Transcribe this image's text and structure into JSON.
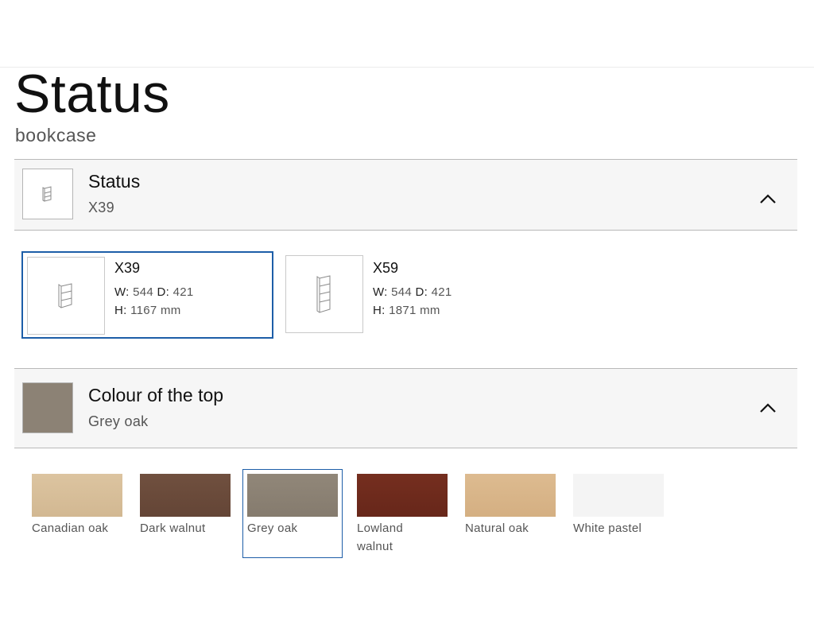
{
  "page": {
    "title": "Status",
    "subtitle": "bookcase"
  },
  "model_section": {
    "title": "Status",
    "value": "X39",
    "icon": "chevron-up-icon"
  },
  "models": [
    {
      "name": "X39",
      "w_label": "W:",
      "w_value": "544",
      "d_label": "D:",
      "d_value": "421",
      "h_label": "H:",
      "h_value": "1167 mm",
      "selected": true
    },
    {
      "name": "X59",
      "w_label": "W:",
      "w_value": "544",
      "d_label": "D:",
      "d_value": "421",
      "h_label": "H:",
      "h_value": "1871 mm",
      "selected": false
    }
  ],
  "colour_section": {
    "title": "Colour of the top",
    "value": "Grey oak",
    "icon": "chevron-up-icon"
  },
  "colours": [
    {
      "label": "Canadian oak",
      "color": "#d8bf9a",
      "selected": false
    },
    {
      "label": "Dark walnut",
      "color": "#6b4a3a",
      "selected": false
    },
    {
      "label": "Grey oak",
      "color": "#8c8275",
      "selected": true
    },
    {
      "label": "Lowland walnut",
      "color": "#6e2a1c",
      "selected": false
    },
    {
      "label": "Natural oak",
      "color": "#d9b68b",
      "selected": false
    },
    {
      "label": "White pastel",
      "color": "#f4f4f4",
      "selected": false
    }
  ],
  "accent_color": "#1d5ea8"
}
